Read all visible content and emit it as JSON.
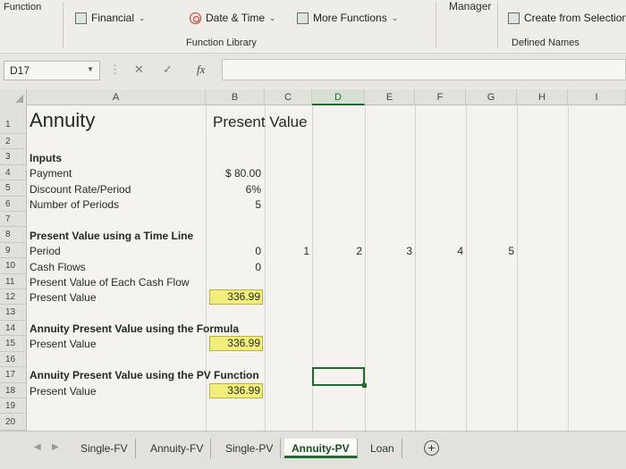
{
  "ribbon": {
    "group_left_label": "Function",
    "financial": "Financial",
    "date_time": "Date & Time",
    "more_functions": "More Functions",
    "function_library": "Function Library",
    "manager": "Manager",
    "create_from_selection": "Create from Selection",
    "defined_names": "Defined Names"
  },
  "formula_bar": {
    "name_box": "D17",
    "cancel": "✕",
    "enter": "✓",
    "fx": "fx",
    "formula": ""
  },
  "columns": [
    "A",
    "B",
    "C",
    "D",
    "E",
    "F",
    "G",
    "H",
    "I"
  ],
  "selected_column": "D",
  "rows": [
    "1",
    "2",
    "3",
    "4",
    "5",
    "6",
    "7",
    "8",
    "9",
    "10",
    "11",
    "12",
    "13",
    "14",
    "15",
    "16",
    "17",
    "18",
    "19",
    "20"
  ],
  "sheet": {
    "title": "Annuity",
    "subtitle": "Present Value",
    "inputs_header": "Inputs",
    "payment_label": "Payment",
    "payment_value": "$ 80.00",
    "rate_label": "Discount Rate/Period",
    "rate_value": "6%",
    "periods_label": "Number of Periods",
    "periods_value": "5",
    "timeline_header": "Present Value using a Time Line",
    "period_label": "Period",
    "periods": [
      "0",
      "1",
      "2",
      "3",
      "4",
      "5"
    ],
    "cash_flows_label": "Cash Flows",
    "cash_flow_0": "0",
    "pv_each_label": "Present Value of Each Cash Flow",
    "pv_label_12": "Present Value",
    "pv_value_12": "336.99",
    "formula_header": "Annuity Present Value using the Formula",
    "pv_label_15": "Present Value",
    "pv_value_15": "336.99",
    "pvfunc_header": "Annuity Present Value using the PV Function",
    "pv_label_18": "Present Value",
    "pv_value_18": "336.99"
  },
  "tabs": [
    "Single-FV",
    "Annuity-FV",
    "Single-PV",
    "Annuity-PV",
    "Loan"
  ],
  "active_tab": "Annuity-PV",
  "colors": {
    "accent": "#1e6b2d",
    "highlight": "#f3ee7b"
  }
}
